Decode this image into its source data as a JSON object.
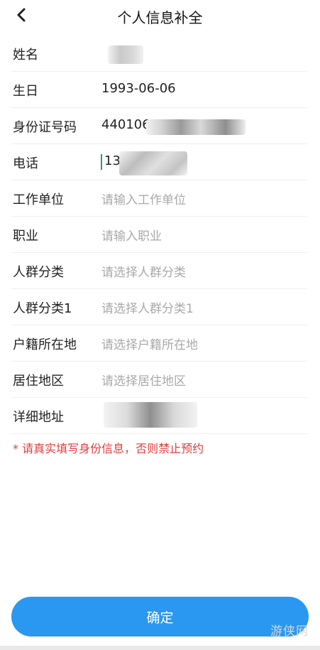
{
  "header": {
    "title": "个人信息补全"
  },
  "fields": [
    {
      "label": "姓名",
      "value": ""
    },
    {
      "label": "生日",
      "value": "1993-06-06"
    },
    {
      "label": "身份证号码",
      "value": "440106"
    },
    {
      "label": "电话",
      "value": "13"
    },
    {
      "label": "工作单位",
      "placeholder": "请输入工作单位"
    },
    {
      "label": "职业",
      "placeholder": "请输入职业"
    },
    {
      "label": "人群分类",
      "placeholder": "请选择人群分类"
    },
    {
      "label": "人群分类1",
      "placeholder": "请选择人群分类1"
    },
    {
      "label": "户籍所在地",
      "placeholder": "请选择户籍所在地"
    },
    {
      "label": "居住地区",
      "placeholder": "请选择居住地区"
    },
    {
      "label": "详细地址",
      "value": ""
    }
  ],
  "warning": "* 请真实填写身份信息，否则禁止预约",
  "confirm_label": "确定",
  "watermark": "游侠网",
  "colors": {
    "accent": "#2a98f0",
    "warning": "#e23c3c",
    "placeholder": "#a9a9a9"
  }
}
